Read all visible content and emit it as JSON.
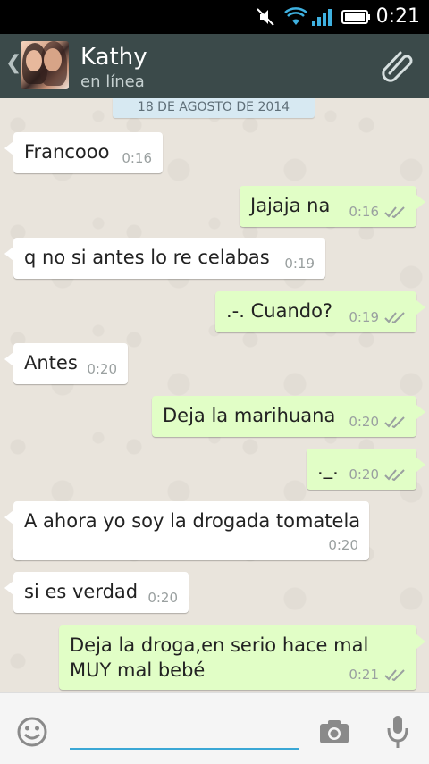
{
  "status_bar": {
    "time": "0:21"
  },
  "header": {
    "contact_name": "Kathy",
    "contact_status": "en línea"
  },
  "chat": {
    "date_label": "18 DE AGOSTO DE 2014",
    "messages": [
      {
        "dir": "in",
        "text": "Francooo",
        "time": "0:16"
      },
      {
        "dir": "out",
        "text": "Jajaja na",
        "time": "0:16"
      },
      {
        "dir": "in",
        "text": "q no si antes lo re celabas",
        "time": "0:19"
      },
      {
        "dir": "out",
        "text": ".-. Cuando?",
        "time": "0:19"
      },
      {
        "dir": "in",
        "text": "Antes",
        "time": "0:20"
      },
      {
        "dir": "out",
        "text": "Deja la marihuana",
        "time": "0:20"
      },
      {
        "dir": "out",
        "text": "._.",
        "time": "0:20"
      },
      {
        "dir": "in",
        "text": "A ahora yo soy la drogada tomatela",
        "time": "0:20"
      },
      {
        "dir": "in",
        "text": "si es verdad",
        "time": "0:20"
      },
      {
        "dir": "out",
        "text_line1": "Deja la droga,en serio hace mal",
        "text_line2": "MUY mal bebé",
        "time": "0:21"
      }
    ]
  },
  "input": {
    "placeholder": ""
  },
  "icons": {
    "back": "chevron-left-icon",
    "attach": "paperclip-icon",
    "emoji": "smiley-icon",
    "camera": "camera-icon",
    "mic": "microphone-icon"
  },
  "colors": {
    "header_bg": "#3b4a4a",
    "out_bubble": "#e1fec6",
    "in_bubble": "#ffffff",
    "accent": "#3aa7d5"
  }
}
